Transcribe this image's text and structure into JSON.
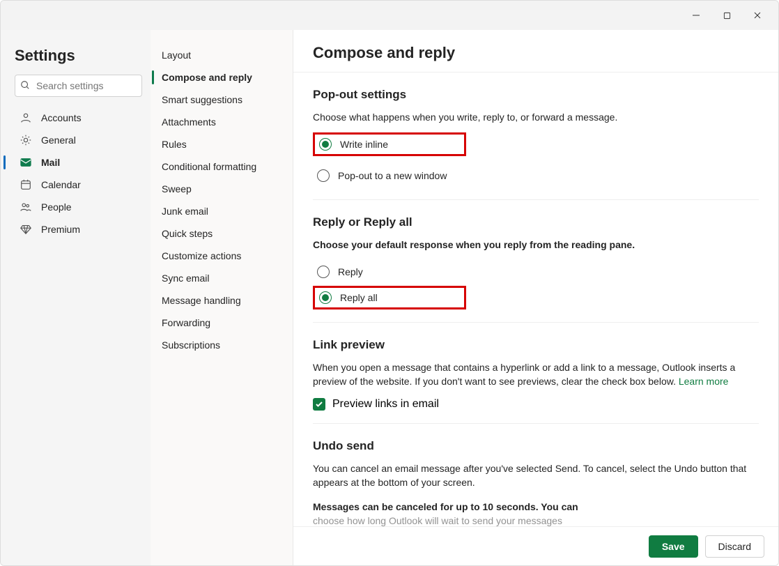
{
  "window": {
    "title": "Settings"
  },
  "sidebar": {
    "title": "Settings",
    "search_placeholder": "Search settings",
    "items": [
      {
        "label": "Accounts"
      },
      {
        "label": "General"
      },
      {
        "label": "Mail"
      },
      {
        "label": "Calendar"
      },
      {
        "label": "People"
      },
      {
        "label": "Premium"
      }
    ],
    "active": "Mail"
  },
  "subnav": {
    "items": [
      {
        "label": "Layout"
      },
      {
        "label": "Compose and reply"
      },
      {
        "label": "Smart suggestions"
      },
      {
        "label": "Attachments"
      },
      {
        "label": "Rules"
      },
      {
        "label": "Conditional formatting"
      },
      {
        "label": "Sweep"
      },
      {
        "label": "Junk email"
      },
      {
        "label": "Quick steps"
      },
      {
        "label": "Customize actions"
      },
      {
        "label": "Sync email"
      },
      {
        "label": "Message handling"
      },
      {
        "label": "Forwarding"
      },
      {
        "label": "Subscriptions"
      }
    ],
    "active": "Compose and reply"
  },
  "main": {
    "title": "Compose and reply",
    "popout": {
      "heading": "Pop-out settings",
      "desc": "Choose what happens when you write, reply to, or forward a message.",
      "option_inline": "Write inline",
      "option_window": "Pop-out to a new window",
      "selected": "inline"
    },
    "replyall": {
      "heading": "Reply or Reply all",
      "desc": "Choose your default response when you reply from the reading pane.",
      "option_reply": "Reply",
      "option_replyall": "Reply all",
      "selected": "replyall"
    },
    "linkpreview": {
      "heading": "Link preview",
      "desc_pre": "When you open a message that contains a hyperlink or add a link to a message, Outlook inserts a preview of the website. If you don't want to see previews, clear the check box below. ",
      "learn_more": "Learn more",
      "checkbox_label": "Preview links in email",
      "checked": true
    },
    "undosend": {
      "heading": "Undo send",
      "desc": "You can cancel an email message after you've selected Send. To cancel, select the Undo button that appears at the bottom of your screen.",
      "msg_line": "Messages can be canceled for up to 10 seconds. You can",
      "msg_line2": "choose how long Outlook will wait to send your messages"
    }
  },
  "footer": {
    "save": "Save",
    "discard": "Discard"
  }
}
